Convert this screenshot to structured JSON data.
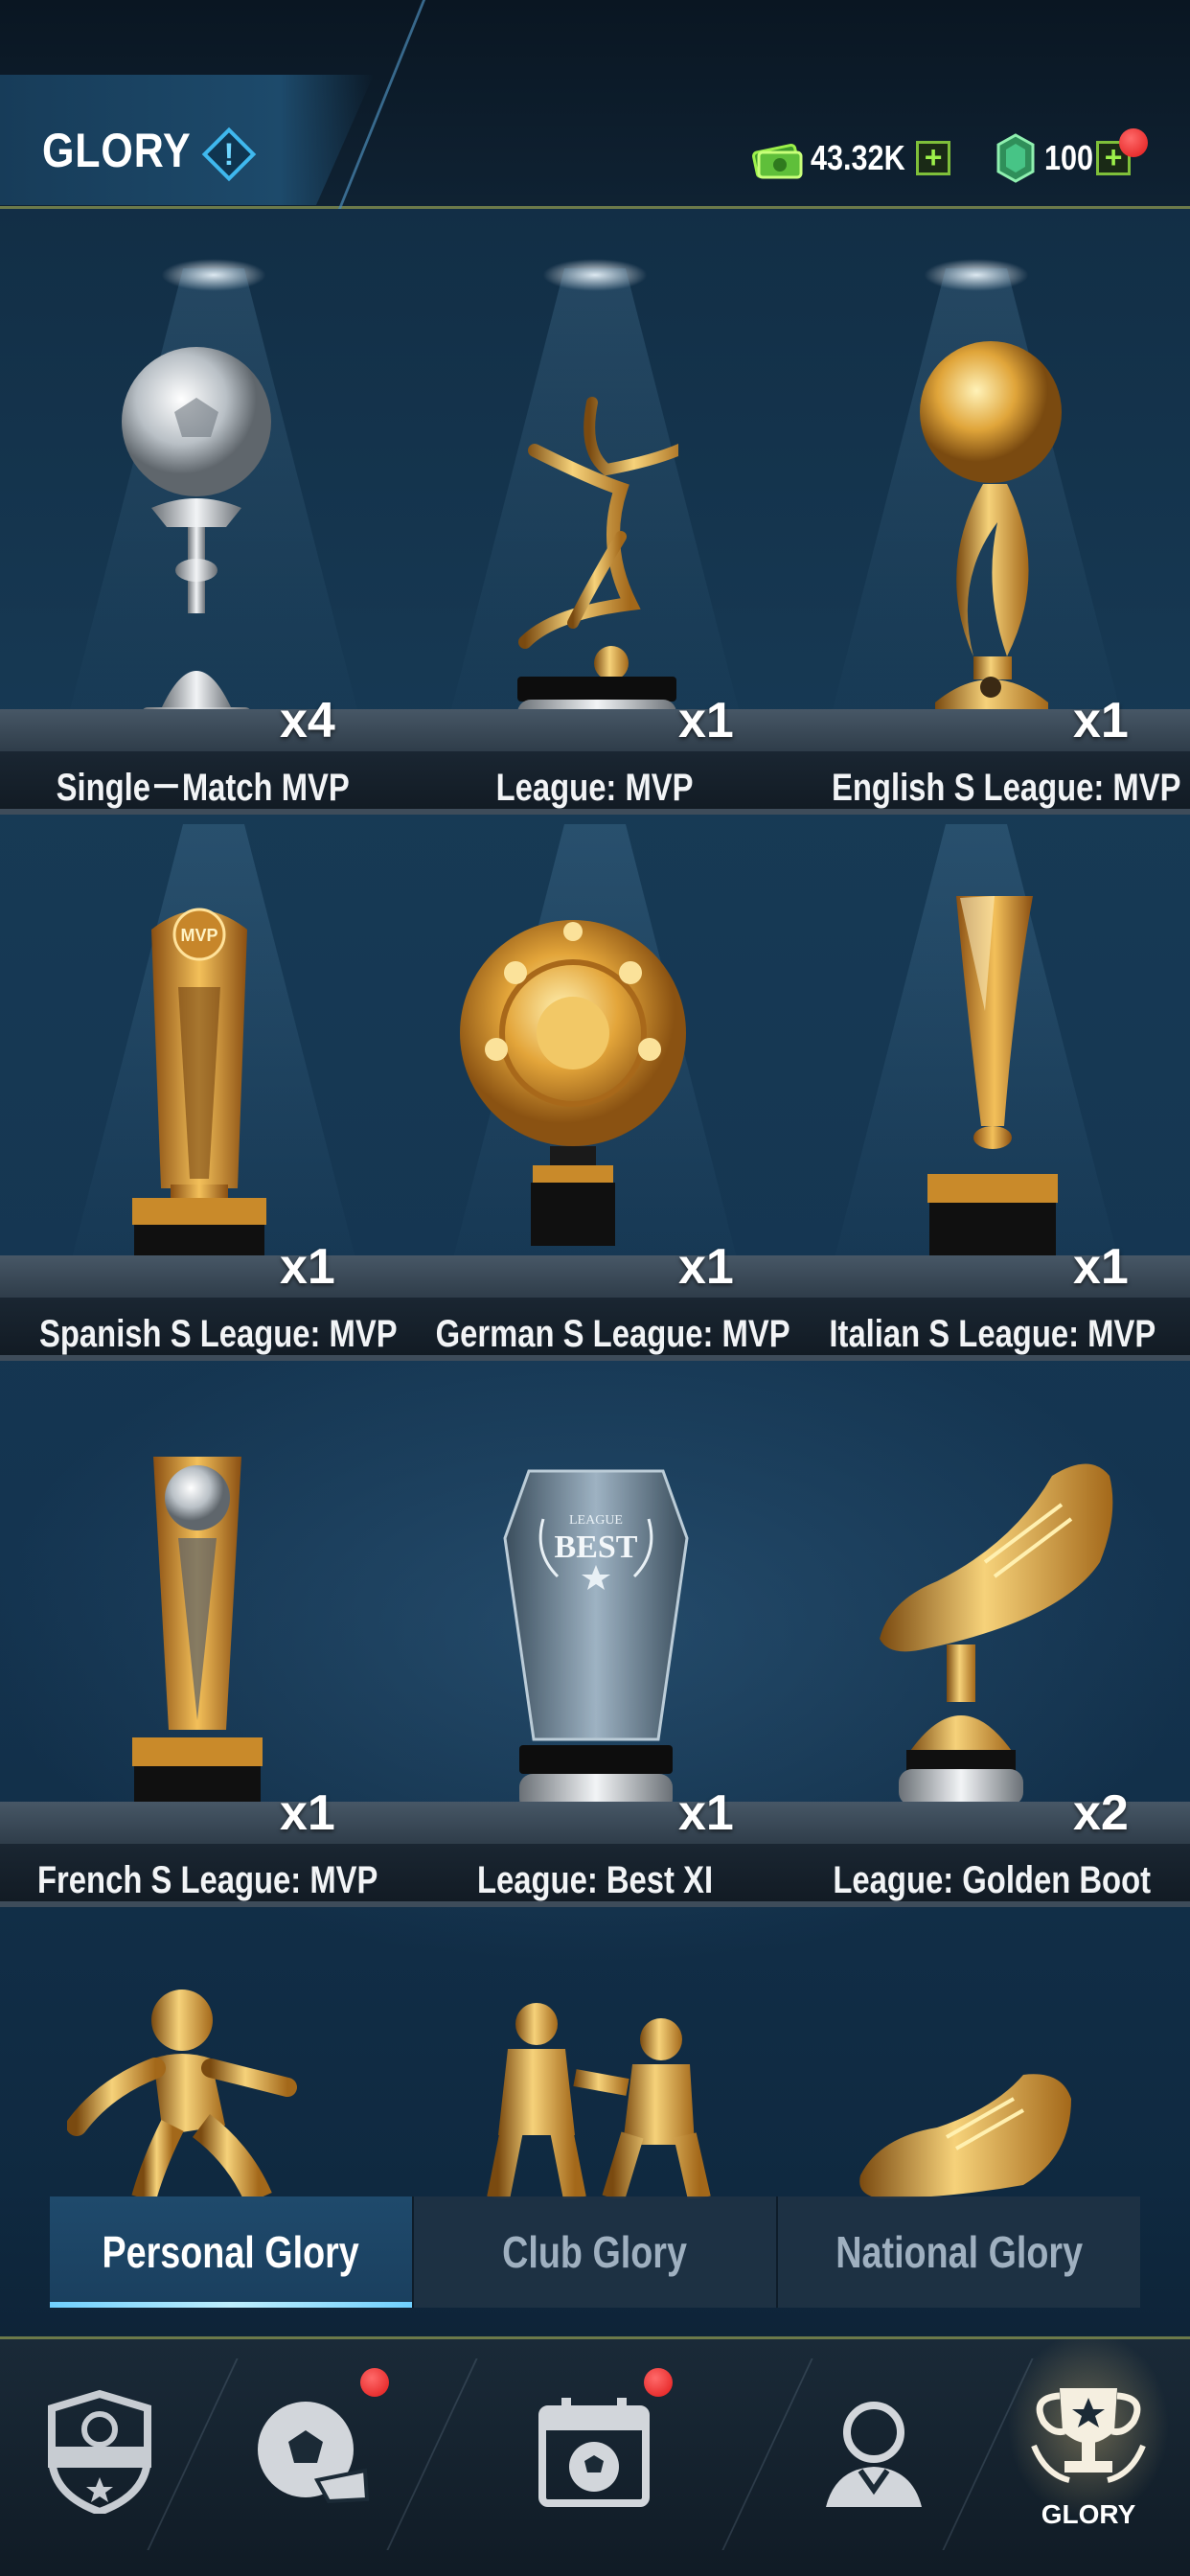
{
  "header": {
    "title": "GLORY",
    "info_icon": "info-diamond-icon",
    "cash": {
      "icon": "cash-icon",
      "value": "43.32K"
    },
    "gems": {
      "icon": "gem-icon",
      "value": "100"
    }
  },
  "shelves": [
    {
      "trophies": [
        {
          "name": "Single－Match MVP",
          "count": "x4",
          "icon": "silver-ball-trophy-icon"
        },
        {
          "name": "League: MVP",
          "count": "x1",
          "icon": "gold-figure-trophy-icon"
        },
        {
          "name": "English S League: MVP",
          "count": "x1",
          "icon": "gold-ball-flame-trophy-icon"
        }
      ]
    },
    {
      "trophies": [
        {
          "name": "Spanish S League: MVP",
          "count": "x1",
          "icon": "mvp-pillar-trophy-icon"
        },
        {
          "name": "German S League: MVP",
          "count": "x1",
          "icon": "gold-plate-trophy-icon"
        },
        {
          "name": "Italian S League: MVP",
          "count": "x1",
          "icon": "gold-spiral-trophy-icon"
        }
      ]
    },
    {
      "trophies": [
        {
          "name": "French S League: MVP",
          "count": "x1",
          "icon": "gold-ball-pillar-trophy-icon"
        },
        {
          "name": "League: Best XI",
          "count": "x1",
          "icon": "crystal-best-trophy-icon",
          "engraving_top": "LEAGUE",
          "engraving_main": "BEST"
        },
        {
          "name": "League: Golden Boot",
          "count": "x2",
          "icon": "golden-boot-trophy-icon"
        }
      ]
    }
  ],
  "tabs": [
    {
      "label": "Personal Glory",
      "active": true
    },
    {
      "label": "Club Glory",
      "active": false
    },
    {
      "label": "National Glory",
      "active": false
    }
  ],
  "bottom_nav": [
    {
      "icon": "club-badge-icon",
      "label": "",
      "badge": false
    },
    {
      "icon": "ball-whistle-icon",
      "label": "",
      "badge": true
    },
    {
      "icon": "calendar-ball-icon",
      "label": "",
      "badge": true
    },
    {
      "icon": "player-avatar-icon",
      "label": "",
      "badge": false
    },
    {
      "icon": "glory-trophy-icon",
      "label": "GLORY",
      "badge": false,
      "active": true
    }
  ],
  "colors": {
    "accent_active_tab": "#1f4a6c",
    "gold": "#d9a63a",
    "badge_red": "#e01818",
    "plus_green": "#9df04a"
  }
}
